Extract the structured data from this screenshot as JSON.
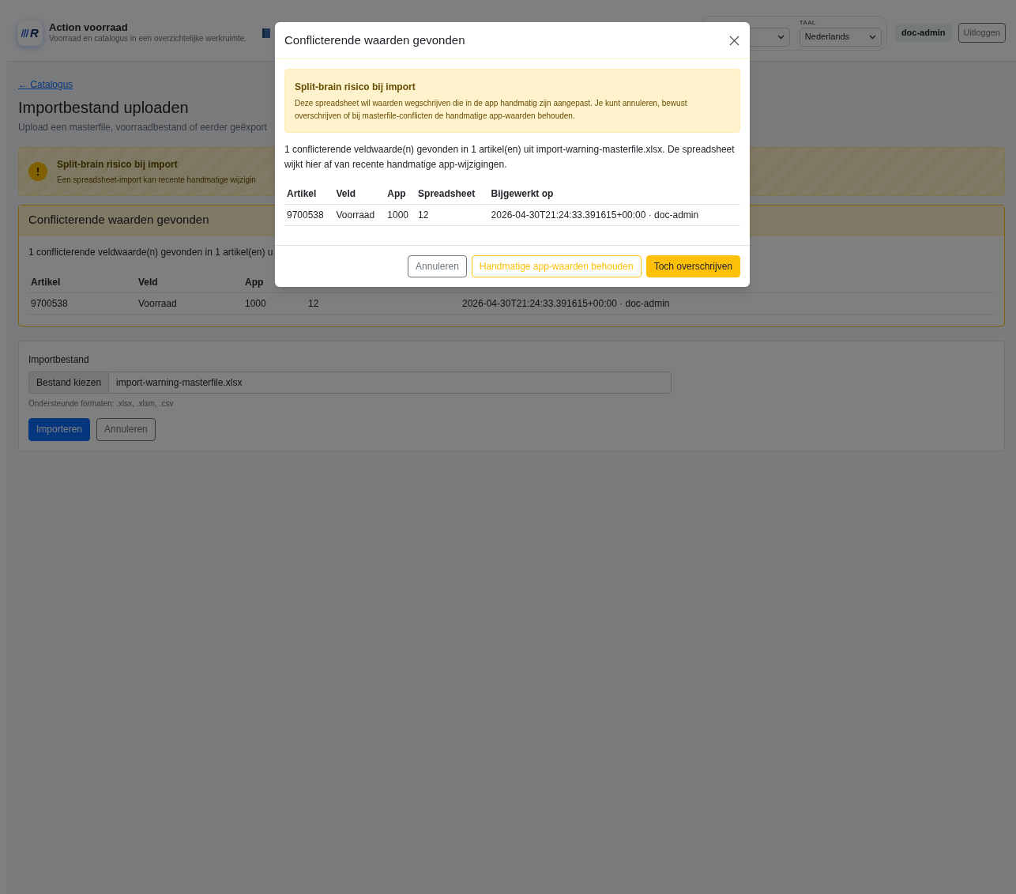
{
  "header": {
    "logo_text": "R",
    "app_title": "Action voorraad",
    "app_subtitle": "Voorraad en catalogus in een overzichtelijke werkruimte.",
    "language_label": "TAAL",
    "language_value": "Nederlands",
    "user": "doc-admin",
    "logout": "Uitloggen"
  },
  "page": {
    "back_link": "← Catalogus",
    "title": "Importbestand uploaden",
    "subtitle": "Upload een masterfile, voorraadbestand of eerder geëxport"
  },
  "warning": {
    "title": "Split-brain risico bij import",
    "text": "Een spreadsheet-import kan recente handmatige wijzigin"
  },
  "conflicts_card": {
    "title": "Conflicterende waarden gevonden",
    "summary": "1 conflicterende veldwaarde(n) gevonden in 1 artikel(en) u",
    "columns": [
      "Artikel",
      "Veld",
      "App"
    ],
    "rows": [
      {
        "cells": [
          "9700538",
          "Voorraad",
          "1000",
          "12",
          "2026-04-30T21:24:33.391615+00:00 · doc-admin"
        ]
      }
    ]
  },
  "import_form": {
    "label": "Importbestand",
    "choose_button": "Bestand kiezen",
    "file_name": "import-warning-masterfile.xlsx",
    "help": "Ondersteunde formaten: .xlsx, .xlsm, .csv",
    "buttons": [
      {
        "label": "Importeren",
        "kind": "primary"
      },
      {
        "label": "Annuleren",
        "kind": "secondary"
      }
    ]
  },
  "modal": {
    "title": "Conflicterende waarden gevonden",
    "alert": {
      "title": "Split-brain risico bij import",
      "text": "Deze spreadsheet wil waarden wegschrijven die in de app handmatig zijn aangepast. Je kunt annuleren, bewust overschrijven of bij masterfile-conflicten de handmatige app-waarden behouden."
    },
    "summary": "1 conflicterende veldwaarde(n) gevonden in 1 artikel(en) uit import-warning-masterfile.xlsx. De spreadsheet wijkt hier af van recente handmatige app-wijzigingen.",
    "columns": [
      "Artikel",
      "Veld",
      "App",
      "Spreadsheet",
      "Bijgewerkt op"
    ],
    "rows": [
      {
        "cells": [
          "9700538",
          "Voorraad",
          "1000",
          "12",
          "2026-04-30T21:24:33.391615+00:00 · doc-admin"
        ]
      }
    ],
    "buttons": [
      {
        "label": "Annuleren",
        "kind": "secondary"
      },
      {
        "label": "Handmatige app-waarden behouden",
        "kind": "warning-outline"
      },
      {
        "label": "Toch overschrijven",
        "kind": "warning"
      }
    ]
  }
}
